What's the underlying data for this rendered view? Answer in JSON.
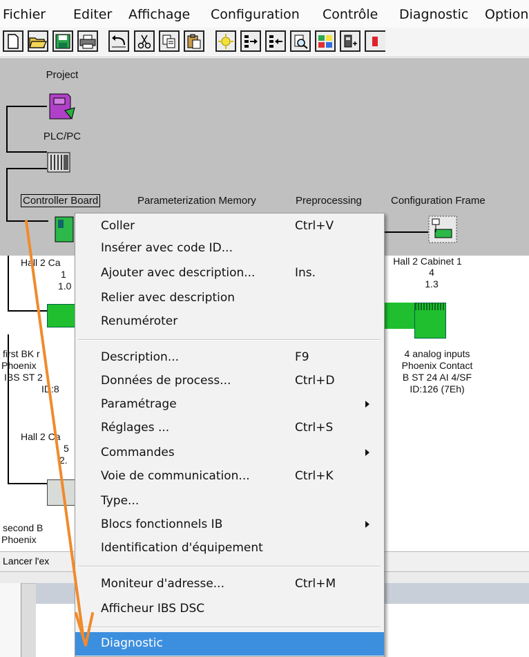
{
  "menubar": {
    "items": [
      "Fichier",
      "Editer",
      "Affichage",
      "Configuration",
      "Contrôle",
      "Diagnostic",
      "Option"
    ]
  },
  "toolbar": {
    "buttons": [
      "new-icon",
      "open-icon",
      "save-icon",
      "print-icon",
      "undo-icon",
      "cut-icon",
      "copy-icon",
      "paste-icon",
      "online-icon",
      "bus-down-icon",
      "bus-up-icon",
      "search-device-icon",
      "parameterize-icon",
      "device-icon",
      "stop-icon"
    ]
  },
  "canvas": {
    "project_label": "Project",
    "plc_label": "PLC/PC",
    "tabs": [
      "Controller Board",
      "Parameterization Memory",
      "Preprocessing",
      "Configuration Frame"
    ]
  },
  "tree": {
    "left_device_1": [
      "Hall 2 Ca",
      "1",
      "1.0"
    ],
    "left_device_2": [
      "first BK r",
      "Phoenix",
      "IBS ST 2",
      "ID:8"
    ],
    "left_device_3": [
      "Hall 2 Ca",
      "5",
      "2."
    ],
    "left_device_4": [
      "second B",
      "Phoenix"
    ],
    "right_device_cab": [
      "Hall 2 Cabinet 1",
      "4",
      "1.3"
    ],
    "right_device_mod": [
      "4 analog inputs",
      "Phoenix Contact",
      "B ST 24 AI 4/SF",
      "ID:126 (7Eh)"
    ]
  },
  "statusbar": {
    "text": "Lancer l'ex"
  },
  "context_menu": {
    "items": [
      {
        "label": "Coller",
        "shortcut": "Ctrl+V"
      },
      {
        "label": "Insérer avec code ID...",
        "shortcut": ""
      },
      {
        "label": "Ajouter avec description...",
        "shortcut": "Ins."
      },
      {
        "label": "Relier avec description",
        "shortcut": ""
      },
      {
        "label": "Renuméroter",
        "shortcut": ""
      },
      {
        "label": "Description...",
        "shortcut": "F9"
      },
      {
        "label": "Données de process...",
        "shortcut": "Ctrl+D"
      },
      {
        "label": "Paramétrage",
        "shortcut": ""
      },
      {
        "label": "Réglages ...",
        "shortcut": "Ctrl+S"
      },
      {
        "label": "Commandes",
        "shortcut": ""
      },
      {
        "label": "Voie de communication...",
        "shortcut": "Ctrl+K"
      },
      {
        "label": "Type...",
        "shortcut": ""
      },
      {
        "label": "Blocs fonctionnels IB",
        "shortcut": ""
      },
      {
        "label": "Identification d'équipement",
        "shortcut": ""
      },
      {
        "label": "Moniteur d'adresse...",
        "shortcut": "Ctrl+M"
      },
      {
        "label": "Afficheur IBS DSC",
        "shortcut": ""
      },
      {
        "label": "Diagnostic",
        "shortcut": ""
      }
    ]
  },
  "colors": {
    "highlight": "#3c8fde",
    "arrow": "#f08a2c",
    "module_green": "#1fbf2f"
  }
}
